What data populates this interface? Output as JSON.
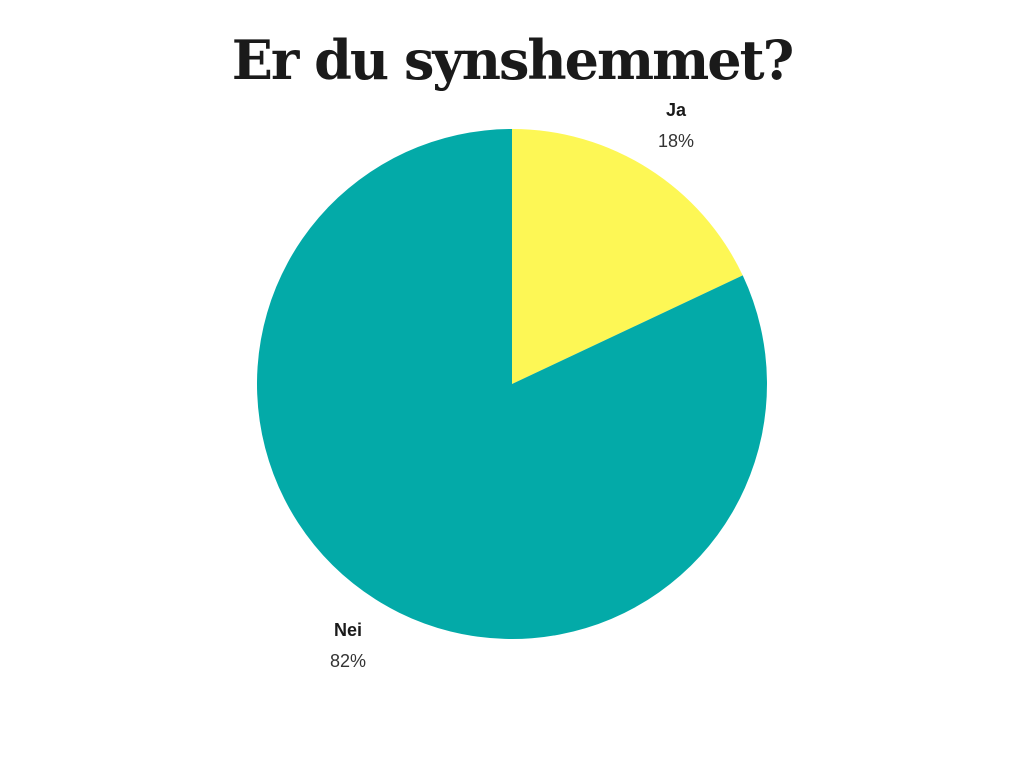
{
  "chart_data": {
    "type": "pie",
    "title": "Er du synshemmet?",
    "categories": [
      "Ja",
      "Nei"
    ],
    "values": [
      18,
      82
    ],
    "value_labels": [
      "18%",
      "82%"
    ],
    "colors": [
      "#fdf755",
      "#03aaa8"
    ],
    "start": "12 o'clock",
    "direction": "clockwise",
    "legend": "none"
  }
}
